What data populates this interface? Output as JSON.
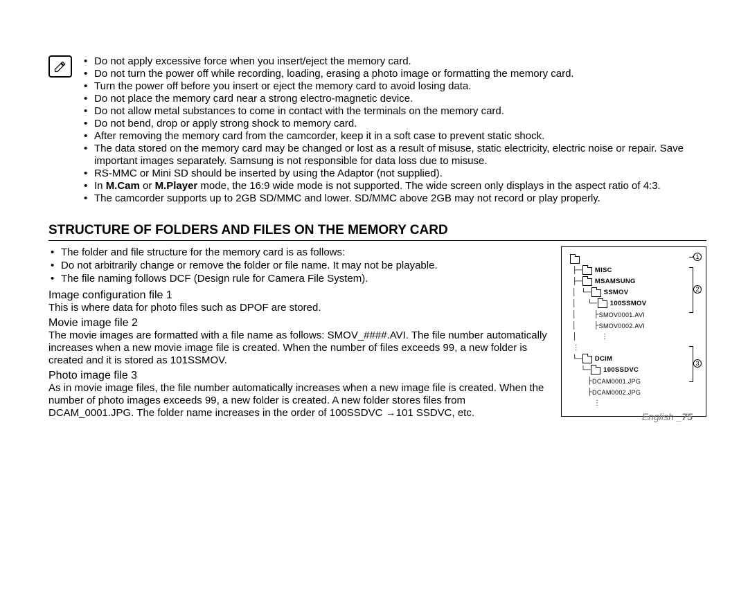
{
  "notes": [
    "Do not apply excessive force when you insert/eject the memory card.",
    "Do not turn the power off while recording, loading, erasing a photo image or formatting the memory card.",
    "Turn the power off before you insert or eject the memory card to avoid losing data.",
    "Do not place the memory card near a strong electro-magnetic device.",
    "Do not allow metal substances to come in contact with the terminals on the memory card.",
    "Do not bend, drop or apply strong shock to memory card.",
    "After removing the memory card from the camcorder, keep it in a soft case to prevent static shock.",
    "The data stored on the memory card may be changed or lost as a result of misuse, static electricity, electric noise or repair. Save important images separately. Samsung is not responsible for data loss due to misuse.",
    "RS-MMC or Mini SD should be inserted by using the Adaptor (not supplied).",
    "In <b>M.Cam</b> or <b>M.Player</b> mode, the 16:9 wide mode is not supported. The wide screen only displays in the aspect ratio of 4:3.",
    "The camcorder supports up to 2GB SD/MMC and lower. SD/MMC above 2GB may not record or play properly."
  ],
  "section_title": "STRUCTURE OF FOLDERS AND FILES ON THE MEMORY CARD",
  "intro": [
    "The folder and file structure for the memory card is as follows:",
    "Do not arbitrarily change or remove the folder or file name. It may not be playable.",
    "The file naming follows DCF (Design rule for Camera File System)."
  ],
  "sub1_h": "Image configuration file 1",
  "sub1_p": "This is where data for photo files such as DPOF are stored.",
  "sub2_h": "Movie image file 2",
  "sub2_p": "The movie images are formatted with a file name as follows: SMOV_####.AVI. The file number automatically increases when a new movie image file is created. When the number of files exceeds 99, a new folder is created and it is stored as 101SSMOV.",
  "sub3_h": "Photo image file 3",
  "sub3_p": "As in movie image files, the file number automatically increases when a new image file is created. When the number of photo images exceeds 99, a new folder is created. A new folder stores files from DCAM_0001.JPG. The folder name increases in the order of 100SSDVC →101 SSDVC, etc.",
  "tree": {
    "misc": "MISC",
    "msamsung": "MSAMSUNG",
    "ssmov": "SSMOV",
    "ssmov100": "100SSMOV",
    "smov1": "SMOV0001.AVI",
    "smov2": "SMOV0002.AVI",
    "dcim": "DCIM",
    "ssdvc100": "100SSDVC",
    "dcam1": "DCAM0001.JPG",
    "dcam2": "DCAM0002.JPG"
  },
  "footer_lang": "English",
  "footer_page": "_75"
}
